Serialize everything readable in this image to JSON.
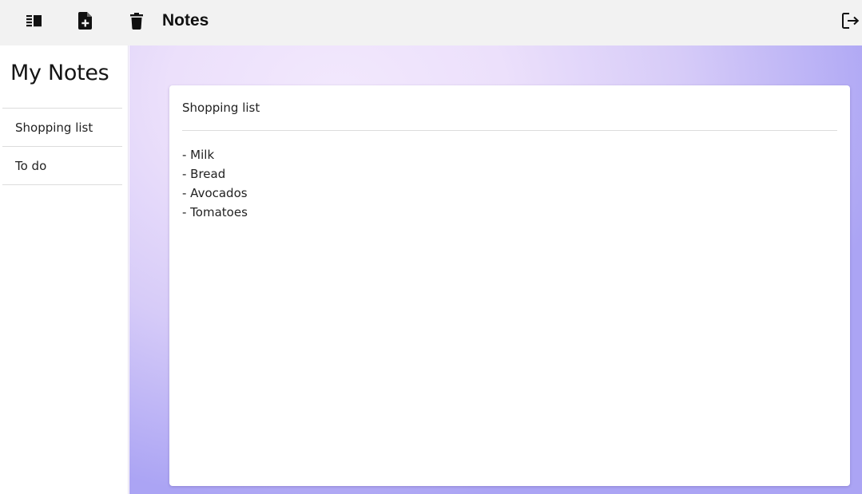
{
  "toolbar": {
    "title": "Notes",
    "buttons": [
      {
        "name": "toggle-sidebar",
        "icon": "sidebar-toggle-icon"
      },
      {
        "name": "new-note",
        "icon": "file-plus-icon"
      },
      {
        "name": "delete-note",
        "icon": "trash-icon"
      },
      {
        "name": "logout",
        "icon": "logout-icon"
      }
    ]
  },
  "sidebar": {
    "title": "My Notes",
    "items": [
      {
        "label": "Shopping list"
      },
      {
        "label": "To do"
      }
    ]
  },
  "note": {
    "title": "Shopping list",
    "lines": [
      "- Milk",
      "- Bread",
      "- Avocados",
      "- Tomatoes"
    ]
  },
  "colors": {
    "toolbar_bg": "#f2f2f2",
    "gradient_light": "#f2e8fd",
    "gradient_dark": "#aba4f4"
  }
}
